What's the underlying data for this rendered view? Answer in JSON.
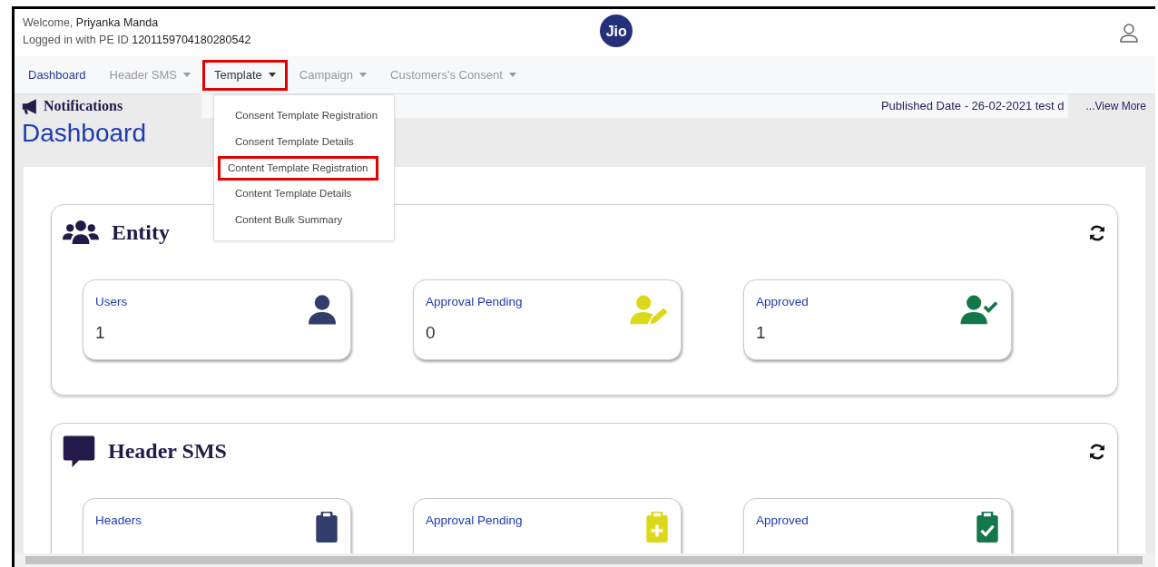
{
  "header": {
    "welcome": "Welcome, **Priyanka Manda**",
    "login": "Logged in with PE ID **1201159704180280542**",
    "logo": "Jio"
  },
  "nav": [
    {
      "label": "Dashboard",
      "dropdown": false,
      "selected": true,
      "highlighted": false
    },
    {
      "label": "Header SMS",
      "dropdown": true,
      "selected": false,
      "highlighted": false
    },
    {
      "label": "Template",
      "dropdown": true,
      "selected": false,
      "highlighted": true,
      "expanded": true,
      "menu": [
        {
          "label": "Consent Template Registration",
          "highlighted": false
        },
        {
          "label": "Consent Template Details",
          "highlighted": false
        },
        {
          "label": "Content Template Registration",
          "highlighted": true
        },
        {
          "label": "Content Template Details",
          "highlighted": false
        },
        {
          "label": "Content Bulk Summary",
          "highlighted": false
        }
      ]
    },
    {
      "label": "Campaign",
      "dropdown": true,
      "selected": false,
      "highlighted": false
    },
    {
      "label": "Customers's Consent",
      "dropdown": true,
      "selected": false,
      "highlighted": false
    }
  ],
  "notifications": {
    "title": "Notifications",
    "ticker": "Published Date - 26-02-2021 test d",
    "view_more": "...View More"
  },
  "page_title": "Dashboard",
  "sections": [
    {
      "title": "Entity",
      "kind": "users",
      "cards": [
        {
          "label": "Users",
          "value": "1",
          "kind": "person",
          "color": "#323d6b"
        },
        {
          "label": "Approval Pending",
          "value": "0",
          "kind": "person-edit",
          "color": "#dcd81a"
        },
        {
          "label": "Approved",
          "value": "1",
          "kind": "person-check",
          "color": "#13774a"
        }
      ]
    },
    {
      "title": "Header SMS",
      "kind": "chat",
      "cards": [
        {
          "label": "Headers",
          "kind": "clipboard",
          "color": "#323d6b"
        },
        {
          "label": "Approval Pending",
          "kind": "clipboard-plus",
          "color": "#dcd81a"
        },
        {
          "label": "Approved",
          "kind": "clipboard-check",
          "color": "#13774a"
        }
      ]
    }
  ]
}
